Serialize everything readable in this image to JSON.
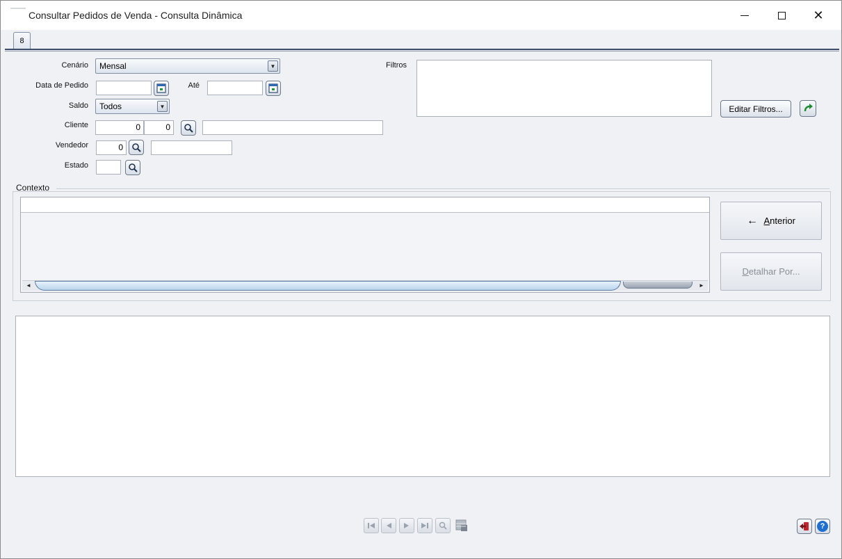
{
  "window": {
    "title": "Consultar Pedidos de Venda - Consulta Dinâmica",
    "minimize_icon": "minimize-icon",
    "maximize_icon": "maximize-icon",
    "close_label": "✕"
  },
  "tabs": [
    {
      "label": "8"
    }
  ],
  "form": {
    "cenario": {
      "label": "Cenário",
      "value": "Mensal"
    },
    "data_pedido": {
      "label": "Data de Pedido",
      "value": ""
    },
    "ate": {
      "label": "Até",
      "value": ""
    },
    "saldo": {
      "label": "Saldo",
      "value": "Todos"
    },
    "cliente": {
      "label": "Cliente",
      "code1": "0",
      "code2": "0",
      "name": ""
    },
    "vendedor": {
      "label": "Vendedor",
      "code": "0",
      "name": ""
    },
    "estado": {
      "label": "Estado",
      "value": ""
    },
    "filtros": {
      "label": "Filtros",
      "value": ""
    },
    "edit_filters_button": "Editar Filtros...",
    "refresh_icon": "refresh-arrow-icon"
  },
  "context": {
    "label": "Contexto",
    "anterior_button": {
      "prefix": "← ",
      "accel": "A",
      "rest": "nterior"
    },
    "detalhar_button": {
      "accel": "D",
      "rest": "etalhar Por..."
    }
  },
  "footer": {
    "nav_icons": [
      "first-record-icon",
      "previous-record-icon",
      "next-record-icon",
      "last-record-icon",
      "search-record-icon",
      "grid-view-icon"
    ],
    "exit_icon": "exit-icon",
    "help_icon": "help-icon",
    "help_label": "?"
  },
  "colors": {
    "title_bar": "#ffffff",
    "background": "#eff1f4",
    "accent_blue": "#1e6fd0",
    "exit_red": "#c0262c"
  }
}
